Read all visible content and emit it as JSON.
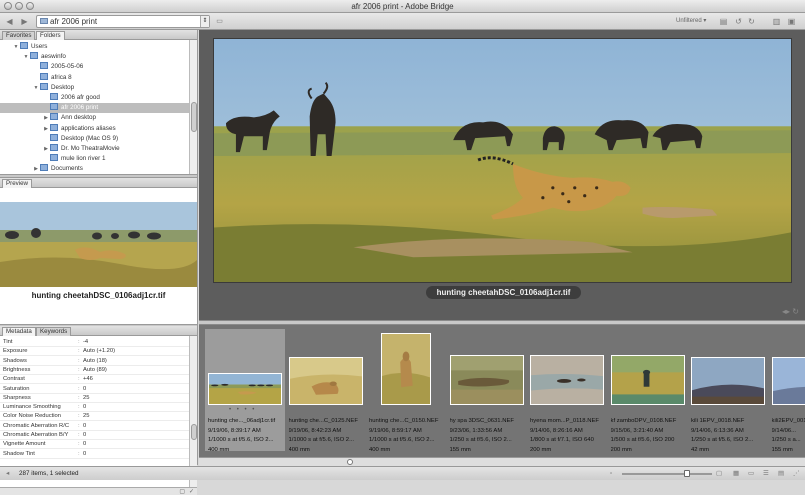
{
  "window": {
    "title": "afr 2006 print - Adobe Bridge"
  },
  "toolbar": {
    "path": "afr 2006 print",
    "filter": "Unfiltered",
    "back_icon": "back-arrow-icon",
    "forward_icon": "forward-arrow-icon"
  },
  "left_tabs": {
    "favorites": "Favorites",
    "folders": "Folders"
  },
  "folders": [
    {
      "label": "Users",
      "depth": 1,
      "expanded": true
    },
    {
      "label": "aeswinfo",
      "depth": 2,
      "expanded": true
    },
    {
      "label": "2005-05-06",
      "depth": 3
    },
    {
      "label": "africa 8",
      "depth": 3
    },
    {
      "label": "Desktop",
      "depth": 3,
      "expanded": true
    },
    {
      "label": "2006 afr good",
      "depth": 4
    },
    {
      "label": "afr 2006 print",
      "depth": 4,
      "selected": true
    },
    {
      "label": "Ann desktop",
      "depth": 4,
      "collapsed": true
    },
    {
      "label": "applications aliases",
      "depth": 4,
      "collapsed": true
    },
    {
      "label": "Desktop (Mac OS 9)",
      "depth": 4
    },
    {
      "label": "Dr. Mo TheatraMovie",
      "depth": 4,
      "collapsed": true
    },
    {
      "label": "mule lion river 1",
      "depth": 4
    },
    {
      "label": "Documents",
      "depth": 3,
      "collapsed": true
    }
  ],
  "preview": {
    "tab": "Preview",
    "caption": "hunting cheetahDSC_0106adj1cr.tif"
  },
  "meta_tabs": {
    "metadata": "Metadata",
    "keywords": "Keywords"
  },
  "metadata": [
    {
      "key": "Tint",
      "value": "-4"
    },
    {
      "key": "Exposure",
      "value": "Auto (+1.20)"
    },
    {
      "key": "Shadows",
      "value": "Auto (18)"
    },
    {
      "key": "Brightness",
      "value": "Auto (89)"
    },
    {
      "key": "Contrast",
      "value": "+46"
    },
    {
      "key": "Saturation",
      "value": "0"
    },
    {
      "key": "Sharpness",
      "value": "25"
    },
    {
      "key": "Luminance Smoothing",
      "value": "0"
    },
    {
      "key": "Color Noise Reduction",
      "value": "25"
    },
    {
      "key": "Chromatic Aberration R/C",
      "value": "0"
    },
    {
      "key": "Chromatic Aberration B/Y",
      "value": "0"
    },
    {
      "key": "Vignette Amount",
      "value": "0"
    },
    {
      "key": "Shadow Tint",
      "value": "0"
    }
  ],
  "main": {
    "caption": "hunting cheetahDSC_0106adj1cr.tif"
  },
  "thumbs": [
    {
      "name": "hunting che..._06adj1cr.tif",
      "date": "9/19/06, 8:39:17 AM",
      "exif": "1/1000 s at f/5.6, ISO 2...",
      "lens": "400 mm",
      "selected": true,
      "scene": "cheetah-wide"
    },
    {
      "name": "hunting che...C_0125.NEF",
      "date": "9/19/06, 8:42:23 AM",
      "exif": "1/1000 s at f/5.6, ISO 2...",
      "lens": "400 mm",
      "scene": "cheetah-grass"
    },
    {
      "name": "hunting che...C_0150.NEF",
      "date": "9/19/06, 8:59:17 AM",
      "exif": "1/1000 s at f/5.6, ISO 2...",
      "lens": "400 mm",
      "scene": "cheetah-portrait"
    },
    {
      "name": "hy spa 3DSC_0631.NEF",
      "date": "9/23/06, 1:33:56 AM",
      "exif": "1/250 s at f/5.6, ISO 2...",
      "lens": "155 mm",
      "scene": "hyena-ground"
    },
    {
      "name": "hyena mom...P_0118.NEF",
      "date": "9/14/06, 8:26:16 AM",
      "exif": "1/800 s at f/7.1, ISO 640",
      "lens": "200 mm",
      "scene": "hyena-water"
    },
    {
      "name": "kf zamboDPV_0108.NEF",
      "date": "9/15/06, 3:21:40 AM",
      "exif": "1/500 s at f/5.6, ISO 200",
      "lens": "200 mm",
      "scene": "bird-field"
    },
    {
      "name": "kili 1EPV_0018.NEF",
      "date": "9/14/06, 6:13:36 AM",
      "exif": "1/250 s at f/5.6, ISO 2...",
      "lens": "42 mm",
      "scene": "kili-dusk"
    },
    {
      "name": "kili2EPV_001...",
      "date": "9/14/06...",
      "exif": "1/250 s a...",
      "lens": "155 mm",
      "scene": "kili-blue"
    }
  ],
  "status": {
    "text": "287 items, 1 selected"
  },
  "colors": {
    "panel_dark": "#5d5d5d",
    "filmstrip": "#747474",
    "selection": "#bdbdbd",
    "folder_blue": "#8fb0db"
  }
}
